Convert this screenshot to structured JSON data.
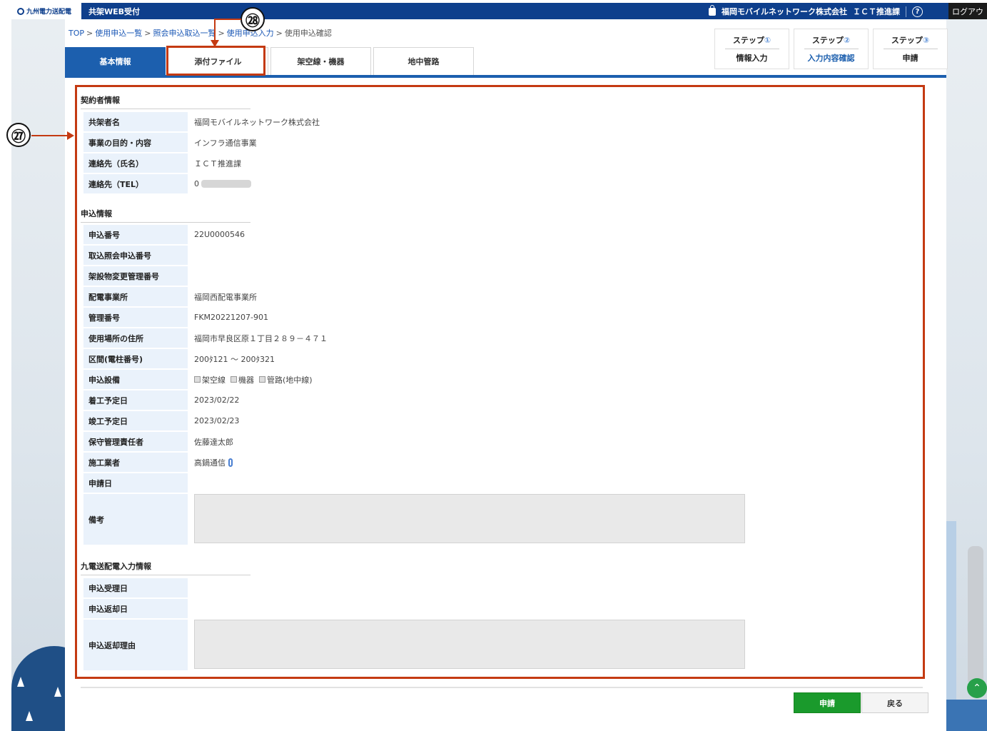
{
  "topbar": {
    "logo_text": "九州電力送配電",
    "app_name": "共架WEB受付",
    "company": "福岡モバイルネットワーク株式会社",
    "department": "ＩＣＴ推進課",
    "help": "?",
    "logout": "ログアウ"
  },
  "breadcrumb": {
    "top": "TOP",
    "list": "使用申込一覧",
    "inquiry": "照会申込取込一覧",
    "entry": "使用申込入力",
    "current": "使用申込確認",
    "sep": ">"
  },
  "tabs": [
    {
      "label": "基本情報",
      "active": true
    },
    {
      "label": "添付ファイル",
      "active": false
    },
    {
      "label": "架空線・機器",
      "active": false
    },
    {
      "label": "地中管路",
      "active": false
    }
  ],
  "steps": [
    {
      "title": "ステップ",
      "num": "①",
      "sub": "情報入力"
    },
    {
      "title": "ステップ",
      "num": "②",
      "sub": "入力内容確認"
    },
    {
      "title": "ステップ",
      "num": "③",
      "sub": "申請"
    }
  ],
  "contractor": {
    "heading": "契約者情報",
    "rows": [
      {
        "label": "共架者名",
        "value": "福岡モバイルネットワーク株式会社"
      },
      {
        "label": "事業の目的・内容",
        "value": "インフラ通信事業"
      },
      {
        "label": "連絡先（氏名）",
        "value": "ＩＣＴ推進課"
      },
      {
        "label": "連絡先（TEL）",
        "value": "0"
      }
    ]
  },
  "application": {
    "heading": "申込情報",
    "rows": [
      {
        "label": "申込番号",
        "value": "22U0000546"
      },
      {
        "label": "取込照会申込番号",
        "value": ""
      },
      {
        "label": "架設物変更管理番号",
        "value": ""
      },
      {
        "label": "配電事業所",
        "value": "福岡西配電事業所"
      },
      {
        "label": "管理番号",
        "value": "FKM20221207-901"
      },
      {
        "label": "使用場所の住所",
        "value": "福岡市早良区原１丁目２８９－４７１"
      },
      {
        "label": "区間(電柱番号)",
        "value": "200ﾀ121 ～ 200ﾀ321"
      },
      {
        "label": "申込設備",
        "value": ""
      },
      {
        "label": "着工予定日",
        "value": "2023/02/22"
      },
      {
        "label": "竣工予定日",
        "value": "2023/02/23"
      },
      {
        "label": "保守管理責任者",
        "value": "佐藤達太郎"
      },
      {
        "label": "施工業者",
        "value": "高鍋通信"
      },
      {
        "label": "申請日",
        "value": ""
      },
      {
        "label": "備考",
        "value": ""
      }
    ],
    "equipment": [
      "架空線",
      "機器",
      "管路(地中線)"
    ]
  },
  "kyuden": {
    "heading": "九電送配電入力情報",
    "rows": [
      {
        "label": "申込受理日",
        "value": ""
      },
      {
        "label": "申込返却日",
        "value": ""
      },
      {
        "label": "申込返却理由",
        "value": ""
      }
    ]
  },
  "buttons": {
    "apply": "申請",
    "back": "戻る"
  },
  "annotations": {
    "a27": "㉗",
    "a28": "㉘"
  },
  "colors": {
    "brand": "#0e3f8c",
    "tab_active": "#1c5fae",
    "label_bg": "#eaf2fb",
    "apply": "#1a9a2c",
    "annotation": "#c43a12"
  }
}
